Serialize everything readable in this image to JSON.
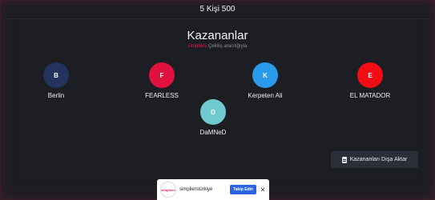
{
  "header": {
    "summary": "5 Kişi 500"
  },
  "results": {
    "title": "Kazananlar",
    "subtitle_brand": "simpliers",
    "subtitle_text": " Çekiliş aracılığıyla"
  },
  "winners": [
    {
      "initial": "B",
      "name": "Berlin",
      "color": "#24325e"
    },
    {
      "initial": "F",
      "name": "FEARLESS",
      "color": "#e0113f"
    },
    {
      "initial": "K",
      "name": "Kerpeten Ali",
      "color": "#2a9bea"
    },
    {
      "initial": "E",
      "name": "EL MATADOR",
      "color": "#f20c13"
    },
    {
      "initial": "D",
      "name": "DaMNeD",
      "color": "#6ec9d0"
    }
  ],
  "actions": {
    "export_label": "Kazananları Dışa Aktar",
    "export_icon": "document-icon"
  },
  "promo": {
    "logo_text": "simpliers",
    "account": "simplierstürkiye",
    "follow_label": "Takip Edin",
    "close_icon": "close-icon"
  }
}
